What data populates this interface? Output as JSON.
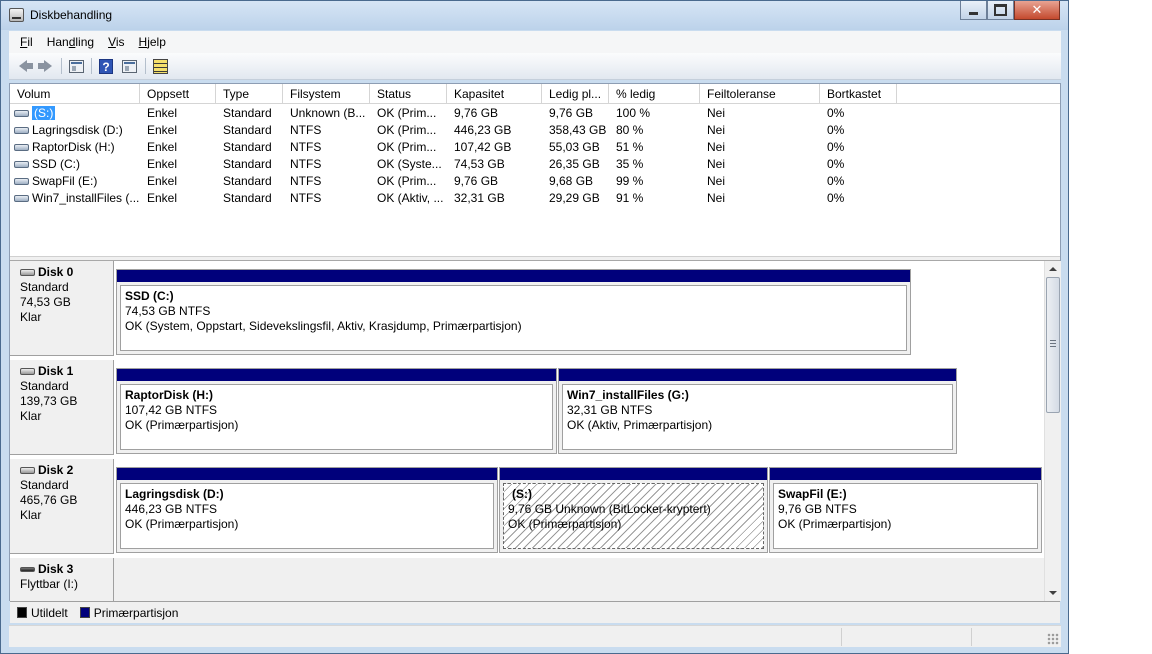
{
  "window": {
    "title": "Diskbehandling"
  },
  "menu": [
    {
      "prefix": "",
      "accel": "F",
      "rest": "il"
    },
    {
      "prefix": "Han",
      "accel": "d",
      "rest": "ling"
    },
    {
      "prefix": "",
      "accel": "V",
      "rest": "is"
    },
    {
      "prefix": "",
      "accel": "H",
      "rest": "jelp"
    }
  ],
  "toolbar": {
    "back_icon": "back-arrow-icon",
    "forward_icon": "forward-arrow-icon",
    "help_icon_text": "?"
  },
  "volume_list": {
    "columns": [
      "Volum",
      "Oppsett",
      "Type",
      "Filsystem",
      "Status",
      "Kapasitet",
      "Ledig pl...",
      "% ledig",
      "Feiltoleranse",
      "Bortkastet"
    ],
    "rows": [
      {
        "volum": "(S:)",
        "oppsett": "Enkel",
        "type": "Standard",
        "filsystem": "Unknown (B...",
        "status": "OK (Prim...",
        "kapasitet": "9,76 GB",
        "ledig": "9,76 GB",
        "prosent": "100 %",
        "feiltoleranse": "Nei",
        "bortkastet": "0%",
        "selected": true
      },
      {
        "volum": "Lagringsdisk  (D:)",
        "oppsett": "Enkel",
        "type": "Standard",
        "filsystem": "NTFS",
        "status": "OK (Prim...",
        "kapasitet": "446,23 GB",
        "ledig": "358,43 GB",
        "prosent": "80 %",
        "feiltoleranse": "Nei",
        "bortkastet": "0%"
      },
      {
        "volum": "RaptorDisk (H:)",
        "oppsett": "Enkel",
        "type": "Standard",
        "filsystem": "NTFS",
        "status": "OK (Prim...",
        "kapasitet": "107,42 GB",
        "ledig": "55,03 GB",
        "prosent": "51 %",
        "feiltoleranse": "Nei",
        "bortkastet": "0%"
      },
      {
        "volum": "SSD (C:)",
        "oppsett": "Enkel",
        "type": "Standard",
        "filsystem": "NTFS",
        "status": "OK (Syste...",
        "kapasitet": "74,53 GB",
        "ledig": "26,35 GB",
        "prosent": "35 %",
        "feiltoleranse": "Nei",
        "bortkastet": "0%"
      },
      {
        "volum": "SwapFil (E:)",
        "oppsett": "Enkel",
        "type": "Standard",
        "filsystem": "NTFS",
        "status": "OK (Prim...",
        "kapasitet": "9,76 GB",
        "ledig": "9,68 GB",
        "prosent": "99 %",
        "feiltoleranse": "Nei",
        "bortkastet": "0%"
      },
      {
        "volum": "Win7_installFiles (...",
        "oppsett": "Enkel",
        "type": "Standard",
        "filsystem": "NTFS",
        "status": "OK (Aktiv, ...",
        "kapasitet": "32,31 GB",
        "ledig": "29,29 GB",
        "prosent": "91 %",
        "feiltoleranse": "Nei",
        "bortkastet": "0%"
      }
    ]
  },
  "disks": [
    {
      "name": "Disk 0",
      "type": "Standard",
      "size": "74,53 GB",
      "state": "Klar",
      "partitions": [
        {
          "name": "SSD  (C:)",
          "size_fs": "74,53 GB NTFS",
          "status": "OK (System, Oppstart, Sidevekslingsfil, Aktiv, Krasjdump, Primærpartisjon)"
        }
      ]
    },
    {
      "name": "Disk 1",
      "type": "Standard",
      "size": "139,73 GB",
      "state": "Klar",
      "partitions": [
        {
          "name": "RaptorDisk  (H:)",
          "size_fs": "107,42 GB NTFS",
          "status": "OK (Primærpartisjon)"
        },
        {
          "name": "Win7_installFiles  (G:)",
          "size_fs": "32,31 GB NTFS",
          "status": "OK (Aktiv, Primærpartisjon)"
        }
      ]
    },
    {
      "name": "Disk 2",
      "type": "Standard",
      "size": "465,76 GB",
      "state": "Klar",
      "partitions": [
        {
          "name": "Lagringsdisk  (D:)",
          "size_fs": "446,23 GB NTFS",
          "status": "OK (Primærpartisjon)"
        },
        {
          "name": "(S:)",
          "size_fs": "9,76 GB Unknown (BitLocker-kryptert)",
          "status": "OK (Primærpartisjon)",
          "hatched": true
        },
        {
          "name": "SwapFil  (E:)",
          "size_fs": "9,76 GB NTFS",
          "status": "OK (Primærpartisjon)"
        }
      ]
    },
    {
      "name": "Disk 3",
      "type": "Flyttbar (I:)",
      "size": "",
      "state": "",
      "partitions": []
    }
  ],
  "legend": [
    {
      "label": "Utildelt",
      "color": "#000000"
    },
    {
      "label": "Primærpartisjon",
      "color": "#00007b"
    }
  ],
  "colors": {
    "partition_bar": "#00007b",
    "selection": "#3399ff"
  }
}
